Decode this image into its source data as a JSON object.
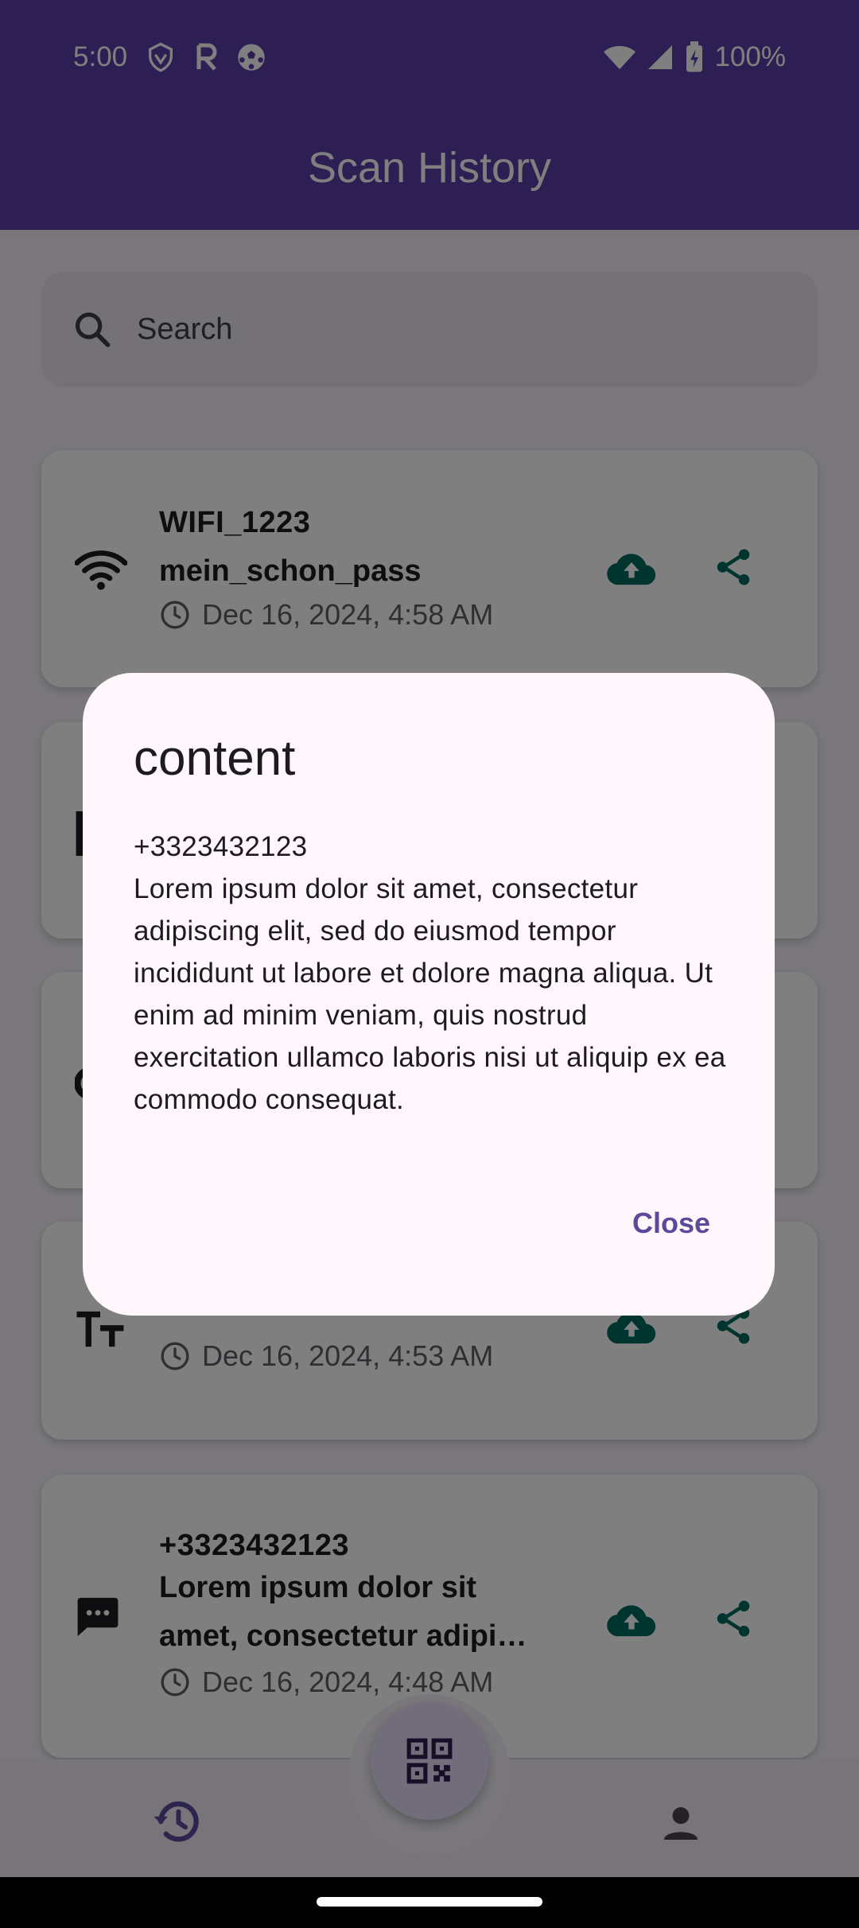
{
  "status_bar": {
    "time": "5:00",
    "battery": "100%",
    "icons": [
      "vpn-shield-icon",
      "r-icon",
      "soccer-ball-icon",
      "wifi-icon",
      "signal-icon",
      "battery-charging-icon"
    ]
  },
  "app_bar": {
    "title": "Scan History"
  },
  "search": {
    "placeholder": "Search"
  },
  "history": [
    {
      "type_icon": "wifi-icon",
      "title": "WIFI_1223",
      "subtitle": "mein_schon_pass",
      "date": "Dec 16, 2024, 4:58 AM"
    },
    {
      "type_icon": "text-icon",
      "title": "",
      "subtitle": "",
      "date": "Dec 16, 2024, 4:53 AM"
    },
    {
      "type_icon": "sms-icon",
      "title": "+3323432123",
      "subtitle": "Lorem ipsum dolor sit amet, consectetur adipi…",
      "date": "Dec 16, 2024, 4:48 AM"
    }
  ],
  "dialog": {
    "title": "content",
    "body": "+3323432123\nLorem ipsum dolor sit amet, consectetur adipiscing elit, sed do eiusmod tempor incididunt ut labore et dolore magna aliqua. Ut enim ad minim veniam, quis nostrud exercitation ullamco laboris nisi ut aliquip ex ea commodo consequat.",
    "close_label": "Close"
  },
  "colors": {
    "primary": "#5b3fa8",
    "accent_green": "#00695c",
    "nav_active": "#5b4a9a",
    "dialog_bg": "#fff7fc"
  }
}
